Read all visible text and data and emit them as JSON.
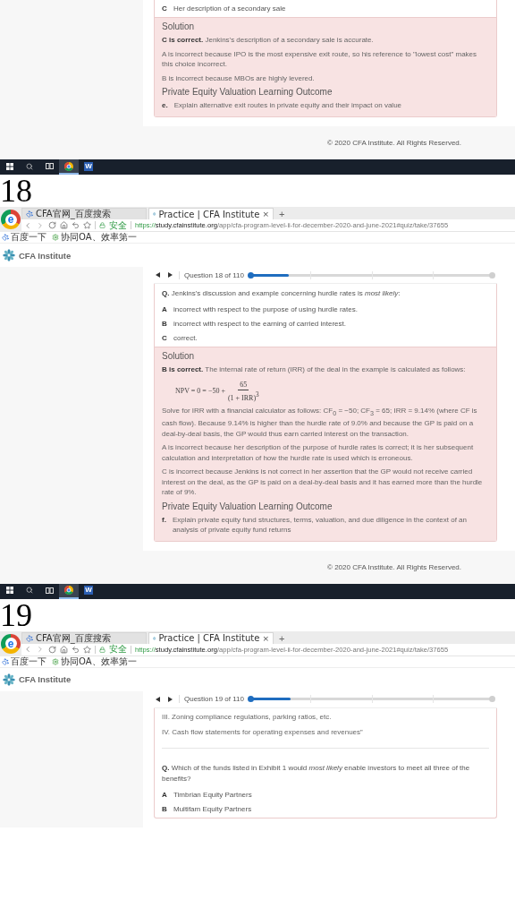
{
  "segments": [
    {
      "kind": "tail",
      "options": [
        {
          "letter": "C",
          "text": "Her description of a secondary sale"
        }
      ],
      "solution": {
        "heading": "Solution",
        "paragraphs": [
          {
            "kind": "text",
            "text": "**C is correct.** Jenkins's description of a secondary sale is accurate."
          },
          {
            "kind": "text",
            "text": "A is incorrect because IPO is the most expensive exit route, so his reference to \"lowest cost\" makes this choice incorrect."
          },
          {
            "kind": "text",
            "text": "B is incorrect because MBOs are highly levered."
          }
        ],
        "outcome_heading": "Private Equity Valuation Learning Outcome",
        "outcomes": [
          {
            "letter": "e.",
            "text": "Explain alternative exit routes in private equity and their impact on value"
          }
        ]
      },
      "footer": "© 2020 CFA Institute. All Rights Reserved.",
      "taskbar": [
        {
          "kind": "start",
          "selected": false
        },
        {
          "kind": "search",
          "selected": false
        },
        {
          "kind": "taskview",
          "selected": false
        },
        {
          "kind": "chrome",
          "selected": true
        },
        {
          "kind": "word",
          "label": "W",
          "selected": false
        }
      ]
    },
    {
      "kind": "capture",
      "number": "18",
      "browser": {
        "logo_letter": "e",
        "tabs": [
          {
            "kind": "search",
            "title": "CFA官网_百度搜索",
            "selected": false
          },
          {
            "kind": "site",
            "title": "Practice | CFA Institute",
            "close": "×",
            "selected": true
          }
        ],
        "new_tab": "+",
        "secure": "安全",
        "url": {
          "scheme": "https://",
          "host": "study.cfainstitute.org",
          "path": "/app/cfa-program-level-ii-for-december-2020-and-june-2021#quiz/take/37655"
        },
        "bookmarks": [
          {
            "kind": "paw",
            "title": "百度一下"
          },
          {
            "kind": "gear",
            "title": "协同OA、效率第一"
          }
        ]
      },
      "site_title": "CFA Institute",
      "nav": {
        "label": "Question 18 of 110",
        "level": 0.16
      },
      "question": "**Q.** Jenkins's discussion and example concerning hurdle rates is *most likely*:",
      "options": [
        {
          "letter": "A",
          "text": "incorrect with respect to the purpose of using hurdle rates."
        },
        {
          "letter": "B",
          "text": "incorrect with respect to the earning of carried interest."
        },
        {
          "letter": "C",
          "text": "correct."
        }
      ],
      "solution": {
        "heading": "Solution",
        "paragraphs": [
          {
            "kind": "text",
            "text": "**B is correct.** The internal rate of return (IRR) of the deal in the example is calculated as follows:"
          },
          {
            "kind": "formula",
            "lhs": "NPV = 0 = −50 +",
            "numerator": "65",
            "denominator": "(1 + IRR)$^{3}$"
          },
          {
            "kind": "text",
            "text": "Solve for IRR with a financial calculator as follows: CF$_{0}$ = −50; CF$_{3}$ = 65; IRR = 9.14% (where CF is cash flow). Because 9.14% is higher than the hurdle rate of 9.0% and because the GP is paid on a deal-by-deal basis, the GP would thus earn carried interest on the transaction."
          },
          {
            "kind": "text",
            "text": "A is incorrect because her description of the purpose of hurdle rates is correct; it is her subsequent calculation and interpretation of how the hurdle rate is used which is erroneous."
          },
          {
            "kind": "text",
            "text": "C is incorrect because Jenkins is not correct in her assertion that the GP would not receive carried interest on the deal, as the GP is paid on a deal-by-deal basis and it has earned more than the hurdle rate of 9%."
          }
        ],
        "outcome_heading": "Private Equity Valuation Learning Outcome",
        "outcomes": [
          {
            "letter": "f.",
            "text": "Explain private equity fund structures, terms, valuation, and due diligence in the context of an analysis of private equity fund returns"
          }
        ]
      },
      "footer": "© 2020 CFA Institute. All Rights Reserved.",
      "taskbar": [
        {
          "kind": "start",
          "selected": false
        },
        {
          "kind": "search",
          "selected": false
        },
        {
          "kind": "taskview",
          "selected": false
        },
        {
          "kind": "chrome",
          "selected": true
        },
        {
          "kind": "word",
          "label": "W",
          "selected": false
        }
      ]
    },
    {
      "kind": "capture",
      "number": "19",
      "browser": {
        "logo_letter": "e",
        "tabs": [
          {
            "kind": "search",
            "title": "CFA官网_百度搜索",
            "selected": false
          },
          {
            "kind": "site",
            "title": "Practice | CFA Institute",
            "close": "×",
            "selected": true
          }
        ],
        "new_tab": "+",
        "secure": "安全",
        "url": {
          "scheme": "https://",
          "host": "study.cfainstitute.org",
          "path": "/app/cfa-program-level-ii-for-december-2020-and-june-2021#quiz/take/37655"
        },
        "bookmarks": [
          {
            "kind": "paw",
            "title": "百度一下"
          },
          {
            "kind": "gear",
            "title": "协同OA、效率第一"
          }
        ]
      },
      "site_title": "CFA Institute",
      "nav": {
        "label": "Question 19 of 110",
        "level": 0.17
      },
      "passage": [
        "III. Zoning compliance regulations, parking ratios, etc.",
        "IV. Cash flow statements for operating expenses and revenues”"
      ],
      "question": "**Q.** Which of the funds listed in Exhibit 1 would *most likely* enable investors to meet all three of the benefits?",
      "options": [
        {
          "letter": "A",
          "text": "Timbrian Equity Partners"
        },
        {
          "letter": "B",
          "text": "Multifam Equity Partners"
        }
      ]
    }
  ]
}
